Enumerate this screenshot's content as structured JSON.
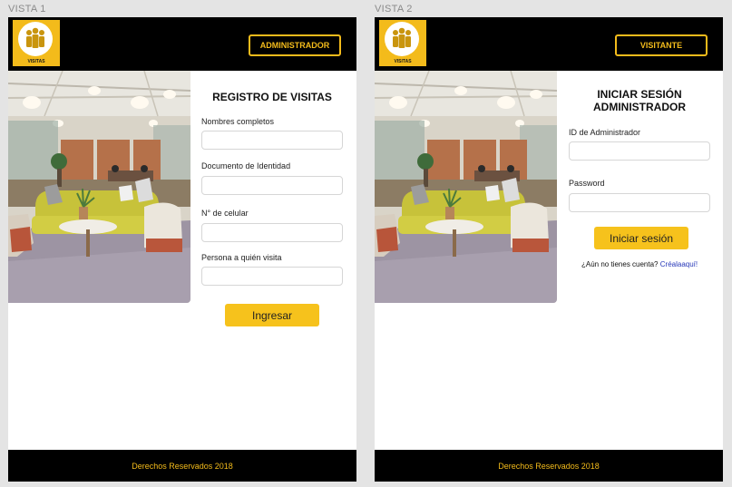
{
  "views": [
    {
      "label": "VISTA 1",
      "logo_text": "VISITAS",
      "header_button": "ADMINISTRADOR",
      "form_title": "REGISTRO DE VISITAS",
      "fields": [
        "Nombres completos",
        "Documento de Identidad",
        "N° de celular",
        "Persona a quién visita"
      ],
      "submit_label": "Ingresar",
      "footer": "Derechos Reservados 2018"
    },
    {
      "label": "VISTA 2",
      "logo_text": "VISITAS",
      "header_button": "VISITANTE",
      "form_title_line1": "INICIAR SESIÓN",
      "form_title_line2": "ADMINISTRADOR",
      "fields": [
        "ID de Administrador",
        "Password"
      ],
      "submit_label": "Iniciar sesión",
      "signup_question": "¿Aún no tienes cuenta?",
      "signup_link": "Créalaaquí!",
      "footer": "Derechos Reservados 2018"
    }
  ],
  "colors": {
    "accent": "#f3bb1b",
    "header_bg": "#000000",
    "link": "#2637b8"
  }
}
